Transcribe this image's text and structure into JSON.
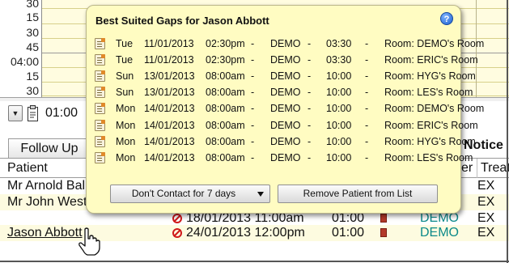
{
  "schedule": {
    "time_labels": [
      "30",
      "15",
      "30",
      "45",
      "04:00",
      "15",
      "30"
    ]
  },
  "toolbar": {
    "time": "01:00"
  },
  "tabs": {
    "follow_up": "Follow Up",
    "notice": "Notice"
  },
  "table": {
    "headers": {
      "patient": "Patient",
      "er": "er",
      "treat": "Treat"
    },
    "rows": [
      {
        "patient": "Mr Arnold Bal",
        "date": "",
        "duration": "",
        "provider": "",
        "treat": "EX"
      },
      {
        "patient": "Mr John West",
        "date": "",
        "duration": "",
        "provider": "",
        "treat": "EX"
      },
      {
        "patient": "",
        "date": "18/01/2013 11:00am",
        "duration": "01:00",
        "provider": "DEMO",
        "treat": "EX"
      },
      {
        "patient": "Jason Abbott",
        "date": "24/01/2013 12:00pm",
        "duration": "01:00",
        "provider": "DEMO",
        "treat": "EX"
      }
    ]
  },
  "popup": {
    "title": "Best Suited Gaps for  Jason Abbott",
    "help": "?",
    "gaps": [
      {
        "day": "Tue",
        "date": "11/01/2013",
        "start": "02:30pm",
        "dash1": "-",
        "provider": "DEMO",
        "dash2": "-",
        "end": "03:30",
        "dash3": "-",
        "room": "Room: DEMO's Room"
      },
      {
        "day": "Tue",
        "date": "11/01/2013",
        "start": "02:30pm",
        "dash1": "-",
        "provider": "DEMO",
        "dash2": "-",
        "end": "03:30",
        "dash3": "-",
        "room": "Room: ERIC's Room"
      },
      {
        "day": "Sun",
        "date": "13/01/2013",
        "start": "08:00am",
        "dash1": "-",
        "provider": "DEMO",
        "dash2": "-",
        "end": "10:00",
        "dash3": "-",
        "room": "Room: HYG's Room"
      },
      {
        "day": "Sun",
        "date": "13/01/2013",
        "start": "08:00am",
        "dash1": "-",
        "provider": "DEMO",
        "dash2": "-",
        "end": "10:00",
        "dash3": "-",
        "room": "Room: LES's Room"
      },
      {
        "day": "Mon",
        "date": "14/01/2013",
        "start": "08:00am",
        "dash1": "-",
        "provider": "DEMO",
        "dash2": "-",
        "end": "10:00",
        "dash3": "-",
        "room": "Room: DEMO's Room"
      },
      {
        "day": "Mon",
        "date": "14/01/2013",
        "start": "08:00am",
        "dash1": "-",
        "provider": "DEMO",
        "dash2": "-",
        "end": "10:00",
        "dash3": "-",
        "room": "Room: ERIC's Room"
      },
      {
        "day": "Mon",
        "date": "14/01/2013",
        "start": "08:00am",
        "dash1": "-",
        "provider": "DEMO",
        "dash2": "-",
        "end": "10:00",
        "dash3": "-",
        "room": "Room: HYG's Room"
      },
      {
        "day": "Mon",
        "date": "14/01/2013",
        "start": "08:00am",
        "dash1": "-",
        "provider": "DEMO",
        "dash2": "-",
        "end": "10:00",
        "dash3": "-",
        "room": "Room: LES's Room"
      }
    ],
    "contact_button": "Don't Contact for 7 days",
    "remove_button": "Remove Patient from List"
  },
  "icons": {
    "gap": "appointment-gap-icon",
    "help": "help-icon",
    "cancel": "no-entry-icon",
    "note": "note-book-icon",
    "cursor": "hand-cursor-icon",
    "clipboard": "clipboard-icon"
  },
  "colors": {
    "popup_bg": "#fffcc2",
    "schedule_bg": "#fffce0",
    "provider_text": "#0c8a8a",
    "cancel_red": "#d0191b"
  }
}
